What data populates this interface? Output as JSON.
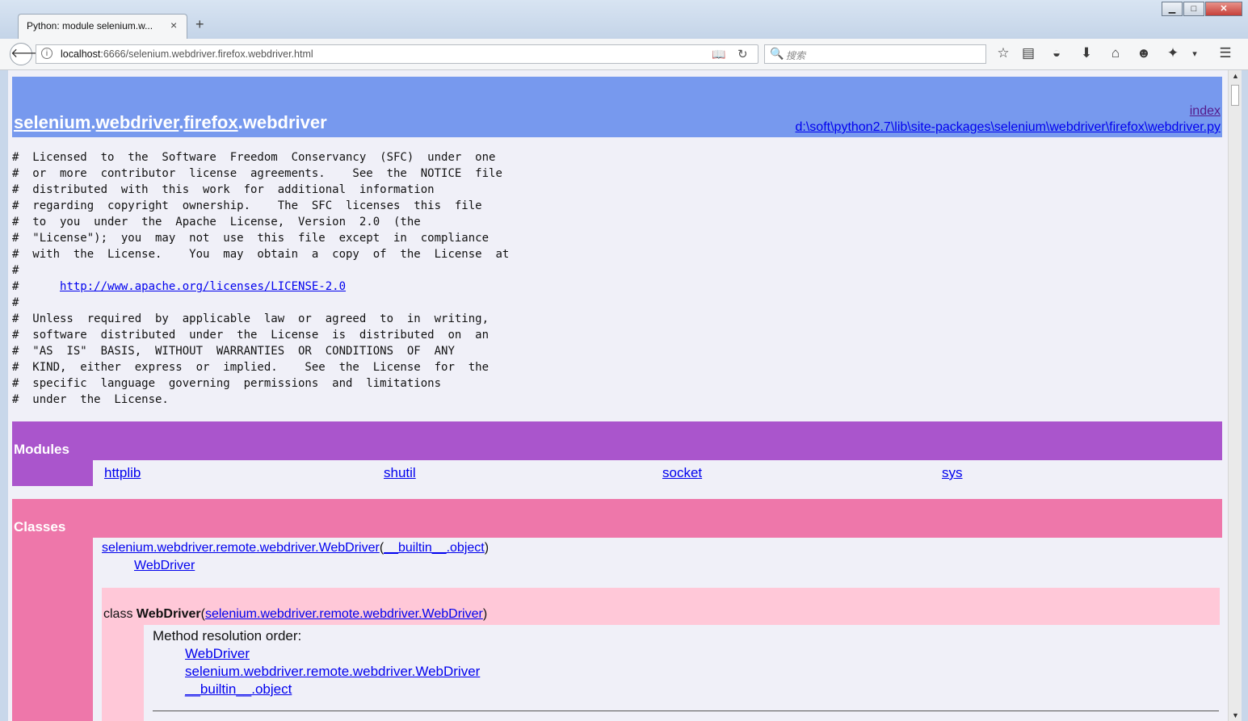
{
  "browser": {
    "tab_title": "Python: module selenium.w...",
    "tab_close": "×",
    "new_tab": "+",
    "window_controls": {
      "minimize": "▁",
      "maximize": "□",
      "close": "✕"
    },
    "url_host": "localhost",
    "url_rest": ":6666/selenium.webdriver.firefox.webdriver.html",
    "search_placeholder": "搜索",
    "icons": [
      "info-icon",
      "reader-view-icon",
      "reload-icon",
      "search-icon",
      "bookmark-star-icon",
      "reading-list-icon",
      "pocket-icon",
      "download-icon",
      "home-icon",
      "feedback-icon",
      "extension-icon",
      "overflow-icon",
      "menu-icon"
    ]
  },
  "page": {
    "header": {
      "title_parts": [
        "selenium",
        "webdriver",
        "firefox"
      ],
      "title_last": "webdriver",
      "index_label": "index",
      "path": "d:\\soft\\python2.7\\lib\\site-packages\\selenium\\webdriver\\firefox\\webdriver.py"
    },
    "license_lines": [
      "#  Licensed  to  the  Software  Freedom  Conservancy  (SFC)  under  one",
      "#  or  more  contributor  license  agreements.    See  the  NOTICE  file",
      "#  distributed  with  this  work  for  additional  information",
      "#  regarding  copyright  ownership.    The  SFC  licenses  this  file",
      "#  to  you  under  the  Apache  License,  Version  2.0  (the",
      "#  \"License\");  you  may  not  use  this  file  except  in  compliance",
      "#  with  the  License.    You  may  obtain  a  copy  of  the  License  at",
      "#",
      "#      ",
      "#",
      "#  Unless  required  by  applicable  law  or  agreed  to  in  writing,",
      "#  software  distributed  under  the  License  is  distributed  on  an",
      "#  \"AS  IS\"  BASIS,  WITHOUT  WARRANTIES  OR  CONDITIONS  OF  ANY",
      "#  KIND,  either  express  or  implied.    See  the  License  for  the",
      "#  specific  language  governing  permissions  and  limitations",
      "#  under  the  License."
    ],
    "license_url": "http://www.apache.org/licenses/LICENSE-2.0",
    "modules_title": "Modules",
    "modules": [
      "httplib",
      "shutil",
      "socket",
      "sys"
    ],
    "classes_title": "Classes",
    "tree_base": "selenium.webdriver.remote.webdriver.WebDriver",
    "tree_base_parent": "__builtin__.object",
    "tree_child": "WebDriver",
    "class_keyword": "class ",
    "class_name": "WebDriver",
    "class_base": "selenium.webdriver.remote.webdriver.WebDriver",
    "mro_label": "Method resolution order:",
    "mro": [
      "WebDriver",
      "selenium.webdriver.remote.webdriver.WebDriver",
      "__builtin__.object"
    ]
  }
}
